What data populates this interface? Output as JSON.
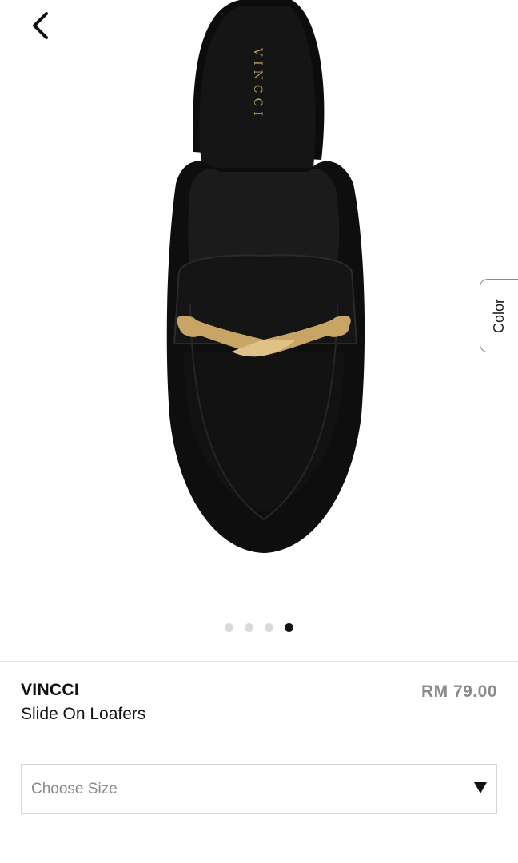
{
  "navigation": {
    "back_icon": "chevron-left-icon"
  },
  "gallery": {
    "image_alt": "Black leather slide-on loafer with gold horsebit hardware",
    "insole_brand": "VINCCI",
    "color_tab_label": "Color",
    "total_images": 4,
    "active_image_index": 3
  },
  "product": {
    "brand": "VINCCI",
    "name": "Slide On Loafers",
    "price": "RM 79.00"
  },
  "size_selector": {
    "placeholder": "Choose Size",
    "caret_icon": "caret-down-icon"
  },
  "colors": {
    "price_color": "#8a8a8a",
    "active_dot": "#111111",
    "inactive_dot": "#d9d9d9"
  }
}
